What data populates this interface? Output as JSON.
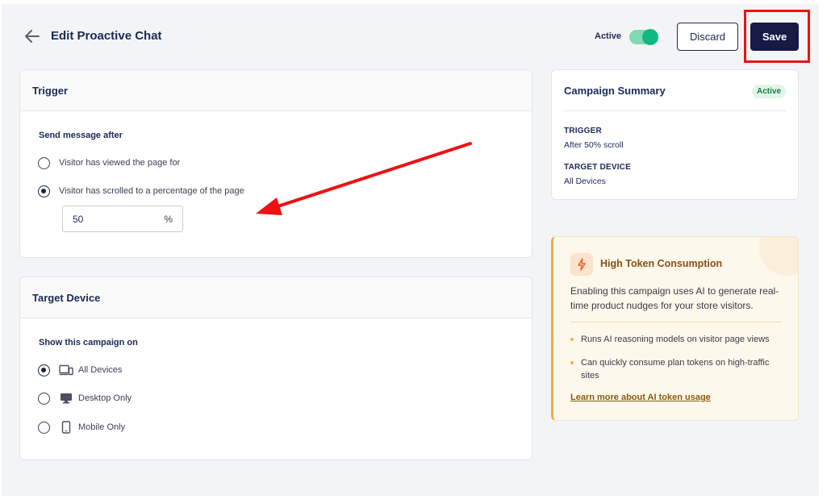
{
  "header": {
    "title": "Edit Proactive Chat",
    "status_label": "Active",
    "discard_label": "Discard",
    "save_label": "Save"
  },
  "trigger_card": {
    "title": "Trigger",
    "section_label": "Send message after",
    "options": [
      {
        "label": "Visitor has viewed the page for",
        "checked": false
      },
      {
        "label": "Visitor has scrolled to a percentage of the page",
        "checked": true
      }
    ],
    "percent_value": "50",
    "percent_unit": "%"
  },
  "target_card": {
    "title": "Target Device",
    "section_label": "Show this campaign on",
    "options": [
      {
        "label": "All Devices",
        "icon": "devices-icon",
        "checked": true
      },
      {
        "label": "Desktop Only",
        "icon": "desktop-icon",
        "checked": false
      },
      {
        "label": "Mobile Only",
        "icon": "mobile-icon",
        "checked": false
      }
    ]
  },
  "summary": {
    "title": "Campaign Summary",
    "badge": "Active",
    "trigger_key": "TRIGGER",
    "trigger_value": "After 50% scroll",
    "device_key": "TARGET DEVICE",
    "device_value": "All Devices"
  },
  "warning": {
    "title": "High Token Consumption",
    "icon": "lightning-icon",
    "description": "Enabling this campaign uses AI to generate real-time product nudges for your store visitors.",
    "bullets": [
      "Runs AI reasoning models on visitor page views",
      "Can quickly consume plan tokens on high-traffic sites"
    ],
    "link": "Learn more about AI token usage"
  },
  "colors": {
    "accent_green": "#10b981",
    "primary_navy": "#171a45",
    "warning_amber": "#f0b23a",
    "annotation_red": "#ee1111"
  }
}
